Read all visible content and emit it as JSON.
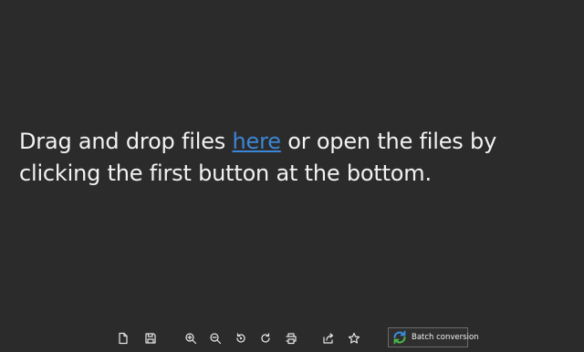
{
  "drop_message": {
    "before_link": "Drag and drop files ",
    "link_text": "here",
    "after_link": " or open the files by clicking the first button at the bottom."
  },
  "toolbar": {
    "buttons": [
      {
        "icon": "open-file-icon"
      },
      {
        "icon": "save-icon"
      },
      {
        "icon": "zoom-in-icon"
      },
      {
        "icon": "zoom-out-icon"
      },
      {
        "icon": "rotate-left-icon"
      },
      {
        "icon": "rotate-right-icon"
      },
      {
        "icon": "print-icon"
      },
      {
        "icon": "share-icon"
      },
      {
        "icon": "star-icon"
      }
    ],
    "batch_conversion_label": "Batch conversion",
    "batch_icon": "convert-arrows-icon"
  },
  "colors": {
    "background": "#2b2b2b",
    "text": "#f2f2f2",
    "link": "#3b86d6",
    "icon": "#e6e6e6",
    "batch_arrow_blue": "#3a8fd9",
    "batch_arrow_green": "#4cb848"
  }
}
